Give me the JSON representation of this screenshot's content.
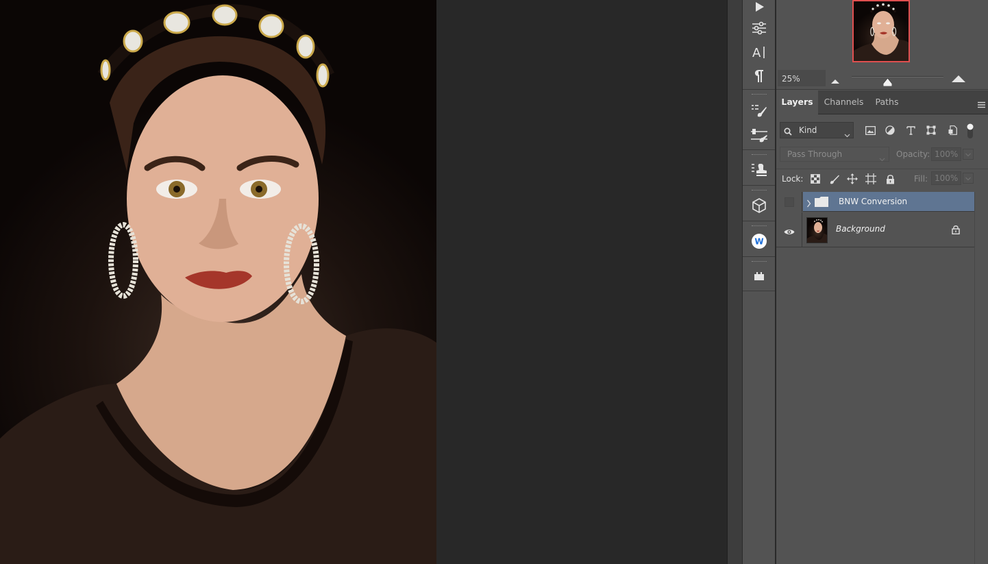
{
  "navigator": {
    "zoom": "25%",
    "zoom_slider_fraction": 0.39
  },
  "layers_panel": {
    "tabs": [
      {
        "label": "Layers",
        "active": true
      },
      {
        "label": "Channels",
        "active": false
      },
      {
        "label": "Paths",
        "active": false
      }
    ],
    "filter": {
      "kind_label": "Kind",
      "filter_icons": [
        "image-filter-icon",
        "adjustment-filter-icon",
        "type-filter-icon",
        "shape-filter-icon",
        "smart-object-filter-icon"
      ]
    },
    "blend_mode": "Pass Through",
    "opacity_label": "Opacity:",
    "opacity_value": "100%",
    "lock_label": "Lock:",
    "lock_icons": [
      "lock-transparent-pixels-icon",
      "lock-image-pixels-icon",
      "lock-position-icon",
      "lock-artboard-icon",
      "lock-all-icon"
    ],
    "fill_label": "Fill:",
    "fill_value": "100%",
    "layers": [
      {
        "name": "BNW Conversion",
        "type": "group",
        "visible": false,
        "selected": true
      },
      {
        "name": "Background",
        "type": "pixel",
        "visible": true,
        "locked": true,
        "selected": false
      }
    ]
  },
  "icon_strip": [
    "play-icon",
    "adjustments-sliders-icon",
    "character-icon",
    "paragraph-icon",
    "brush-settings-icon",
    "brush-presets-icon",
    "clone-source-icon",
    "3d-cube-icon",
    "w-plugin-icon",
    "plugin-icon"
  ],
  "colors": {
    "panel_bg": "#535353",
    "canvas_bg": "#282828",
    "selected_layer": "#5f7592",
    "navigator_frame": "#e04f4f"
  }
}
